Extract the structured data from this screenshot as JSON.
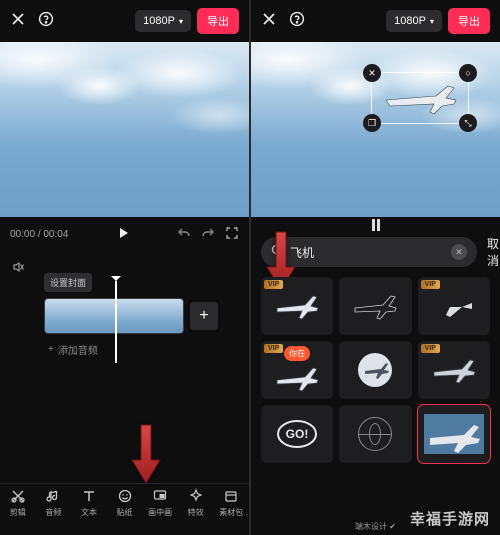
{
  "top": {
    "resolution": "1080P",
    "export": "导出"
  },
  "left": {
    "time_current": "00:00",
    "time_total": "00:04",
    "cover_chip": "设置封面",
    "add_audio": "添加音频",
    "nav": [
      {
        "icon": "scissors",
        "label": "剪辑"
      },
      {
        "icon": "music",
        "label": "音频"
      },
      {
        "icon": "text",
        "label": "文本"
      },
      {
        "icon": "sticker",
        "label": "贴纸"
      },
      {
        "icon": "pip",
        "label": "画中画"
      },
      {
        "icon": "effects",
        "label": "特效"
      },
      {
        "icon": "package",
        "label": "素材包"
      }
    ]
  },
  "right": {
    "search_value": "飞机",
    "cancel": "取消",
    "credit": "端木设计",
    "stickers": [
      {
        "vip": true,
        "kind": "plane-white"
      },
      {
        "vip": false,
        "kind": "plane-outline"
      },
      {
        "vip": true,
        "kind": "plane-silhouette"
      },
      {
        "vip": true,
        "kind": "plane-cartoon-tag",
        "tag": "你在"
      },
      {
        "vip": false,
        "kind": "plane-round"
      },
      {
        "vip": true,
        "kind": "plane-side"
      },
      {
        "vip": false,
        "kind": "go-stamp",
        "text": "GO!"
      },
      {
        "vip": false,
        "kind": "globe"
      },
      {
        "vip": false,
        "kind": "plane-photo",
        "selected": true
      }
    ]
  },
  "watermark": "幸福手游网"
}
